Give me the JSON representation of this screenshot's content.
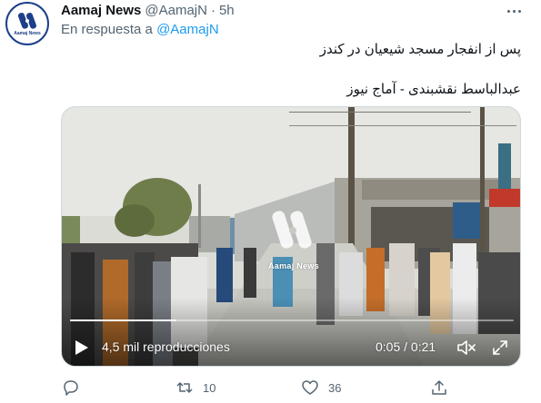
{
  "tweet": {
    "display_name": "Aamaj News",
    "handle": "@AamajN",
    "separator": "·",
    "time": "5h",
    "reply_prefix": "En respuesta a",
    "reply_to": "@AamajN",
    "avatar_label": "Aamaj News",
    "text_line_1": "پس از انفجار مسجد شیعیان در کندز",
    "text_line_2": "عبدالباسط نقشبندی - آماج نیوز"
  },
  "video": {
    "watermark": "Aamaj News",
    "views": "4,5 mil reproducciones",
    "time_current": "0:05",
    "time_separator": "/",
    "time_total": "0:21",
    "progress_fraction": 0.24
  },
  "actions": {
    "reply_count": "",
    "retweet_count": "10",
    "like_count": "36",
    "share_count": ""
  },
  "colors": {
    "accent": "#1d9bf0",
    "secondary_text": "#536471",
    "brand_blue": "#1d3f8a"
  },
  "icons": [
    "more-icon",
    "play-icon",
    "volume-muted-icon",
    "fullscreen-icon",
    "reply-icon",
    "retweet-icon",
    "like-icon",
    "share-icon"
  ]
}
